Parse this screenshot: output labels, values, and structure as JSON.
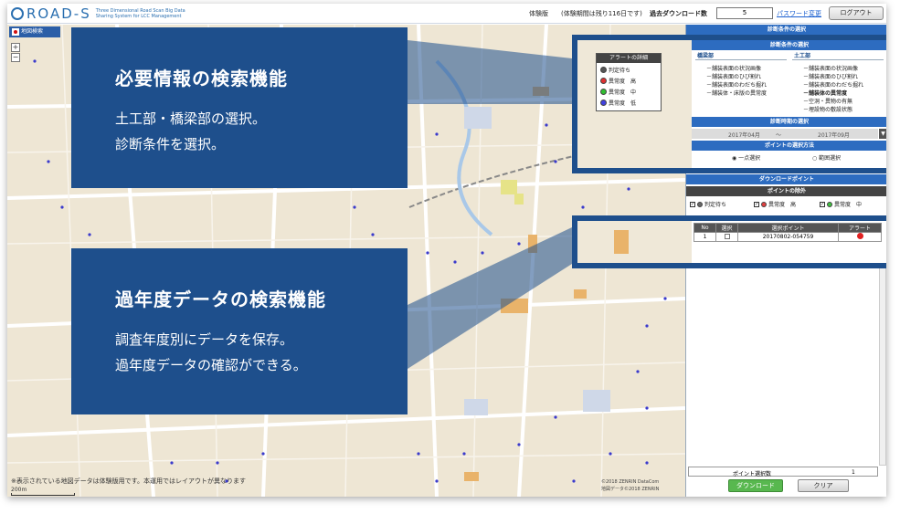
{
  "header": {
    "logo_text": "ROAD-S",
    "logo_sub": "Three Dimensional Road Scan Big Data Sharing System for LCC Management",
    "trial_label": "体験版",
    "trial_period": "(体験期間は残り116日です)",
    "download_label": "過去ダウンロード数",
    "download_count": "5",
    "password_link": "パスワード変更",
    "logout_label": "ログアウト"
  },
  "map": {
    "tab_label": "地図検索",
    "zoom_in": "+",
    "zoom_out": "−",
    "note": "※表示されている地図データは体験版用です。本運用ではレイアウトが異なります",
    "scale": "200m",
    "copyright1": "©2018 ZENRIN DataCom",
    "copyright2": "地図データ©2018 ZENRIN"
  },
  "panel": {
    "conditions_title": "診断条件の選択",
    "bridge_label": "橋梁部",
    "civil_label": "土工部",
    "bridge_items": [
      "－舗装表面の状況画像",
      "－舗装表面のひび割れ",
      "－舗装表面のわだち掘れ",
      "－舗装体・床版の異常度"
    ],
    "civil_items": [
      "－舗装表面の状況画像",
      "－舗装表面のひび割れ",
      "－舗装表面のわだち掘れ",
      "－舗装体の異常度",
      "－空洞・異物の有無",
      "－埋設物の敷設状態"
    ],
    "period_title": "診断時期の選択",
    "period_from": "2017年04月",
    "period_sep": "～",
    "period_to": "2017年09月",
    "method_title": "ポイントの選択方法",
    "method_single": "◉ 一点選択",
    "method_range": "○ 範囲選択",
    "download_point_title": "ダウンロードポイント",
    "exclude_title": "ポイントの除外",
    "legend": [
      {
        "label": "判定待ち",
        "color": "#666666"
      },
      {
        "label": "異常度　高",
        "color": "#e04040"
      },
      {
        "label": "異常度　中",
        "color": "#40c040"
      }
    ],
    "table_headers": [
      "No",
      "選択",
      "選択ポイント",
      "アラート"
    ],
    "table_rows": [
      {
        "no": "1",
        "point": "20170802-054759",
        "alert_color": "#e02020"
      }
    ],
    "count_label": "ポイント選択数",
    "count_value": "1",
    "download_button": "ダウンロード",
    "clear_button": "クリア"
  },
  "inset_alerts": {
    "title": "アラートの詳細",
    "items": [
      {
        "label": "判定待ち",
        "color": "#555555"
      },
      {
        "label": "異常度　高",
        "color": "#e03030"
      },
      {
        "label": "異常度　中",
        "color": "#30c030"
      },
      {
        "label": "異常度　低",
        "color": "#4040e0"
      }
    ]
  },
  "callouts": [
    {
      "title": "必要情報の検索機能",
      "line1": "土工部・橋梁部の選択。",
      "line2": "診断条件を選択。"
    },
    {
      "title": "過年度データの検索機能",
      "line1": "調査年度別にデータを保存。",
      "line2": "過年度データの確認ができる。"
    }
  ]
}
